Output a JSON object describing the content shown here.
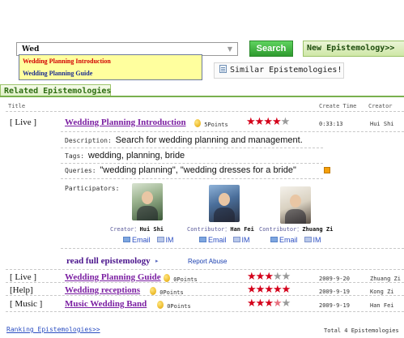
{
  "search": {
    "value": "Wed",
    "button_label": "Search",
    "new_label": "New Epistemology>>",
    "similar_label": "Similar Epistemologies!"
  },
  "autocomplete": [
    "Wedding Planning Introduction",
    "Wedding Planning Guide"
  ],
  "related": {
    "tab_label": "Related Epistemologies",
    "columns": {
      "title": "Title",
      "time": "Create Time",
      "creator": "Creator"
    }
  },
  "rows": [
    {
      "type": "[ Live  ]",
      "title": "Wedding Planning Introduction",
      "points": "5Points",
      "rating": 4,
      "time": "0:33:13",
      "creator": "Hui Shi"
    },
    {
      "type": "[ Live  ]",
      "title": "Wedding Planning Guide",
      "points": "0Points",
      "rating": 3,
      "time": "2009-9-20",
      "creator": "Zhuang Zi"
    },
    {
      "type": "[Help]",
      "title": "Wedding receptions",
      "points": "0Points",
      "rating": 5,
      "time": "2009-9-19",
      "creator": "Kong Zi"
    },
    {
      "type": "[ Music  ]",
      "title": "Music Wedding Band",
      "points": "0Points",
      "rating": 3.5,
      "time": "2009-9-19",
      "creator": "Han Fei"
    }
  ],
  "detail": {
    "description_label": "Description:",
    "description": "Search for wedding planning and management.",
    "tags_label": "Tags:",
    "tags": "wedding, planning, bride",
    "queries_label": "Queries:",
    "queries": "\"wedding planning\", \"wedding dresses for a bride\"",
    "participators_label": "Participators:",
    "participants": [
      {
        "role": "Creator：",
        "name": "Hui Shi"
      },
      {
        "role": "Contributor：",
        "name": "Han Fei"
      },
      {
        "role": "Contributor：",
        "name": "Zhuang Zi"
      }
    ],
    "email_label": "Email",
    "im_label": "IM",
    "read_full": "read full epistemology",
    "read_arrow": "▸",
    "report_abuse": "Report Abuse"
  },
  "footer": {
    "ranking": "Ranking Epistemologies>>",
    "total": "Total 4 Epistemologies"
  },
  "colors": {
    "accent_green": "#2e9a2e",
    "title_purple": "#7b1fa2",
    "star_red": "#d4001a",
    "link_blue": "#2b4ec2",
    "autocomplete_bg": "#ffff9e"
  },
  "icons": [
    "chevron-down-icon",
    "document-icon",
    "coin-icon",
    "star-icon",
    "email-icon",
    "im-icon",
    "orange-badge-icon"
  ]
}
